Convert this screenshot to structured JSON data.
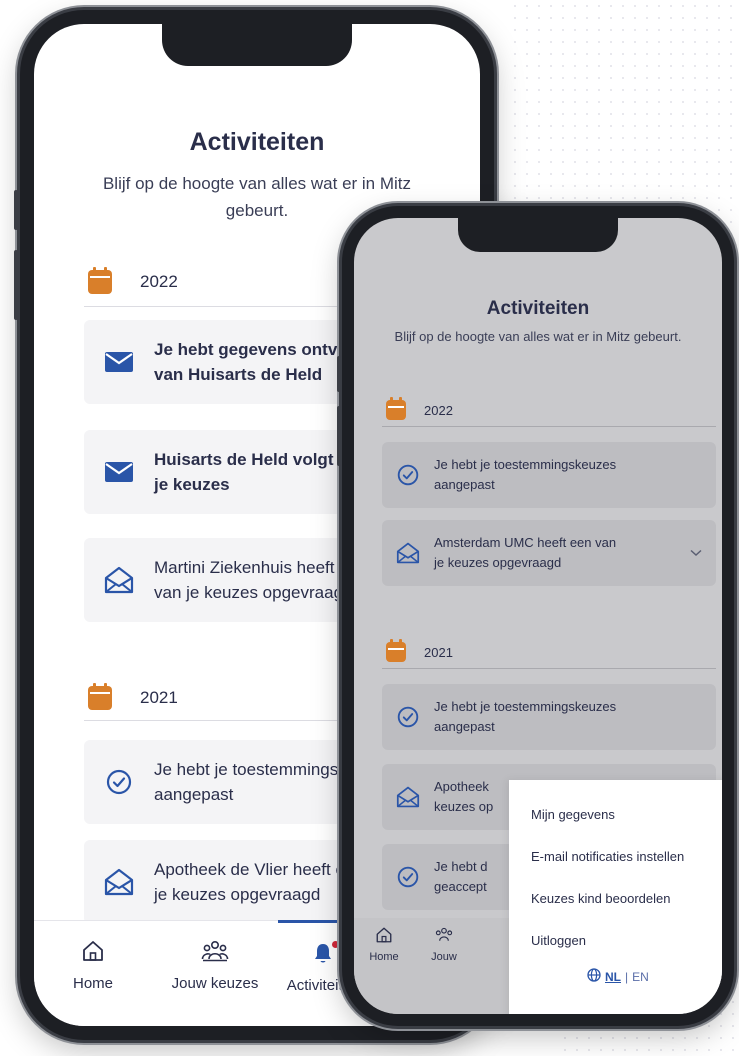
{
  "colors": {
    "accent": "#2a55a8",
    "calendar": "#d97f2a",
    "notification_dot": "#d2283a"
  },
  "phone_main": {
    "title": "Activiteiten",
    "subtitle": "Blijf op de hoogte van alles wat er in Mitz gebeurt.",
    "groups": [
      {
        "year": "2022",
        "items": [
          {
            "icon": "mail-filled-icon",
            "line1": "Je hebt gegevens ontvangen",
            "line2": "van Huisarts de Held",
            "bold": true
          },
          {
            "icon": "mail-filled-icon",
            "line1": "Huisarts de Held volgt van",
            "line2": "je keuzes",
            "bold": true
          },
          {
            "icon": "mail-open-icon",
            "line1": "Martini Ziekenhuis heeft een",
            "line2": "van je keuzes opgevraagd",
            "bold": false
          }
        ]
      },
      {
        "year": "2021",
        "items": [
          {
            "icon": "check-circle-icon",
            "line1": "Je hebt je toestemmingskeuzes",
            "line2": "aangepast",
            "bold": false
          },
          {
            "icon": "mail-open-icon",
            "line1": "Apotheek de Vlier heeft een van",
            "line2": "je keuzes opgevraagd",
            "bold": false
          }
        ]
      }
    ],
    "nav": [
      {
        "icon": "home-icon",
        "label": "Home"
      },
      {
        "icon": "people-icon",
        "label": "Jouw keuzes"
      },
      {
        "icon": "bell-icon",
        "label": "Activiteiten"
      }
    ]
  },
  "phone_second": {
    "title": "Activiteiten",
    "subtitle": "Blijf op de hoogte van alles wat er in Mitz gebeurt.",
    "groups": [
      {
        "year": "2022",
        "items": [
          {
            "icon": "check-circle-icon",
            "line1": "Je hebt je toestemmingskeuzes",
            "line2": "aangepast"
          },
          {
            "icon": "mail-open-icon",
            "line1": "Amsterdam UMC heeft een van",
            "line2": "je keuzes opgevraagd",
            "chevron": true
          }
        ]
      },
      {
        "year": "2021",
        "items": [
          {
            "icon": "check-circle-icon",
            "line1": "Je hebt je toestemmingskeuzes",
            "line2": "aangepast"
          },
          {
            "icon": "mail-open-icon",
            "line1": "Apotheek",
            "line2": "keuzes op"
          },
          {
            "icon": "check-circle-icon",
            "line1": "Je hebt d",
            "line2": "geaccept"
          }
        ]
      }
    ],
    "nav": [
      {
        "icon": "home-icon",
        "label": "Home"
      },
      {
        "icon": "people-icon",
        "label": "Jouw"
      }
    ],
    "menu": {
      "items": [
        "Mijn gegevens",
        "E-mail notificaties instellen",
        "Keuzes kind beoordelen",
        "Uitloggen"
      ],
      "lang_active": "NL",
      "lang_sep": "|",
      "lang_other": "EN"
    }
  }
}
